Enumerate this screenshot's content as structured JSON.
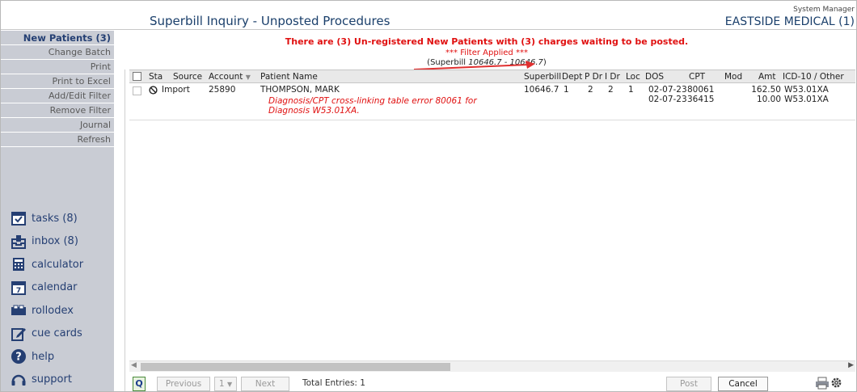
{
  "header": {
    "title": "Superbill Inquiry - Unposted Procedures",
    "user_role": "System Manager",
    "clinic": "EASTSIDE MEDICAL (1)"
  },
  "sidebar": {
    "menu": [
      {
        "label": "New Patients (3)",
        "active": true
      },
      {
        "label": "Change Batch"
      },
      {
        "label": "Print"
      },
      {
        "label": "Print to Excel"
      },
      {
        "label": "Add/Edit Filter"
      },
      {
        "label": "Remove Filter"
      },
      {
        "label": "Journal"
      },
      {
        "label": "Refresh"
      }
    ],
    "tools": [
      {
        "label": "tasks (8)",
        "icon": "tasks-icon"
      },
      {
        "label": "inbox (8)",
        "icon": "inbox-icon"
      },
      {
        "label": "calculator",
        "icon": "calculator-icon"
      },
      {
        "label": "calendar",
        "icon": "calendar-icon"
      },
      {
        "label": "rollodex",
        "icon": "rollodex-icon"
      },
      {
        "label": "cue cards",
        "icon": "cue-cards-icon"
      },
      {
        "label": "help",
        "icon": "help-icon"
      },
      {
        "label": "support",
        "icon": "support-icon"
      }
    ]
  },
  "notice": {
    "message": "There are (3) Un-registered New Patients with (3) charges waiting to be posted.",
    "filter": "*** Filter Applied ***",
    "range_prefix": "(Superbill ",
    "range_value": "10646.7 - 10646.7",
    "range_suffix": ")"
  },
  "table": {
    "headers": {
      "sta": "Sta",
      "source": "Source",
      "account": "Account",
      "patient": "Patient Name",
      "superbill": "Superbill",
      "dept": "Dept",
      "pdr": "P Dr",
      "idr": "I Dr",
      "loc": "Loc",
      "dos": "DOS",
      "cpt": "CPT",
      "mod": "Mod",
      "amt": "Amt",
      "icd": "ICD-10 / Other"
    },
    "row": {
      "source": "Import",
      "account": "25890",
      "patient": "THOMPSON, MARK",
      "error": "Diagnosis/CPT cross-linking table error 80061 for Diagnosis W53.01XA.",
      "superbill": "10646.7",
      "dept": "1",
      "pdr": "2",
      "idr": "2",
      "loc": "1",
      "dos": [
        "02-07-23",
        "02-07-23"
      ],
      "cpt": [
        "80061",
        "36415"
      ],
      "amt": [
        "162.50",
        "10.00"
      ],
      "icd": [
        "W53.01XA",
        "W53.01XA"
      ]
    }
  },
  "footer": {
    "q": "Q",
    "previous": "Previous",
    "page": "1",
    "next": "Next",
    "total": "Total Entries: 1",
    "post": "Post",
    "cancel": "Cancel"
  }
}
